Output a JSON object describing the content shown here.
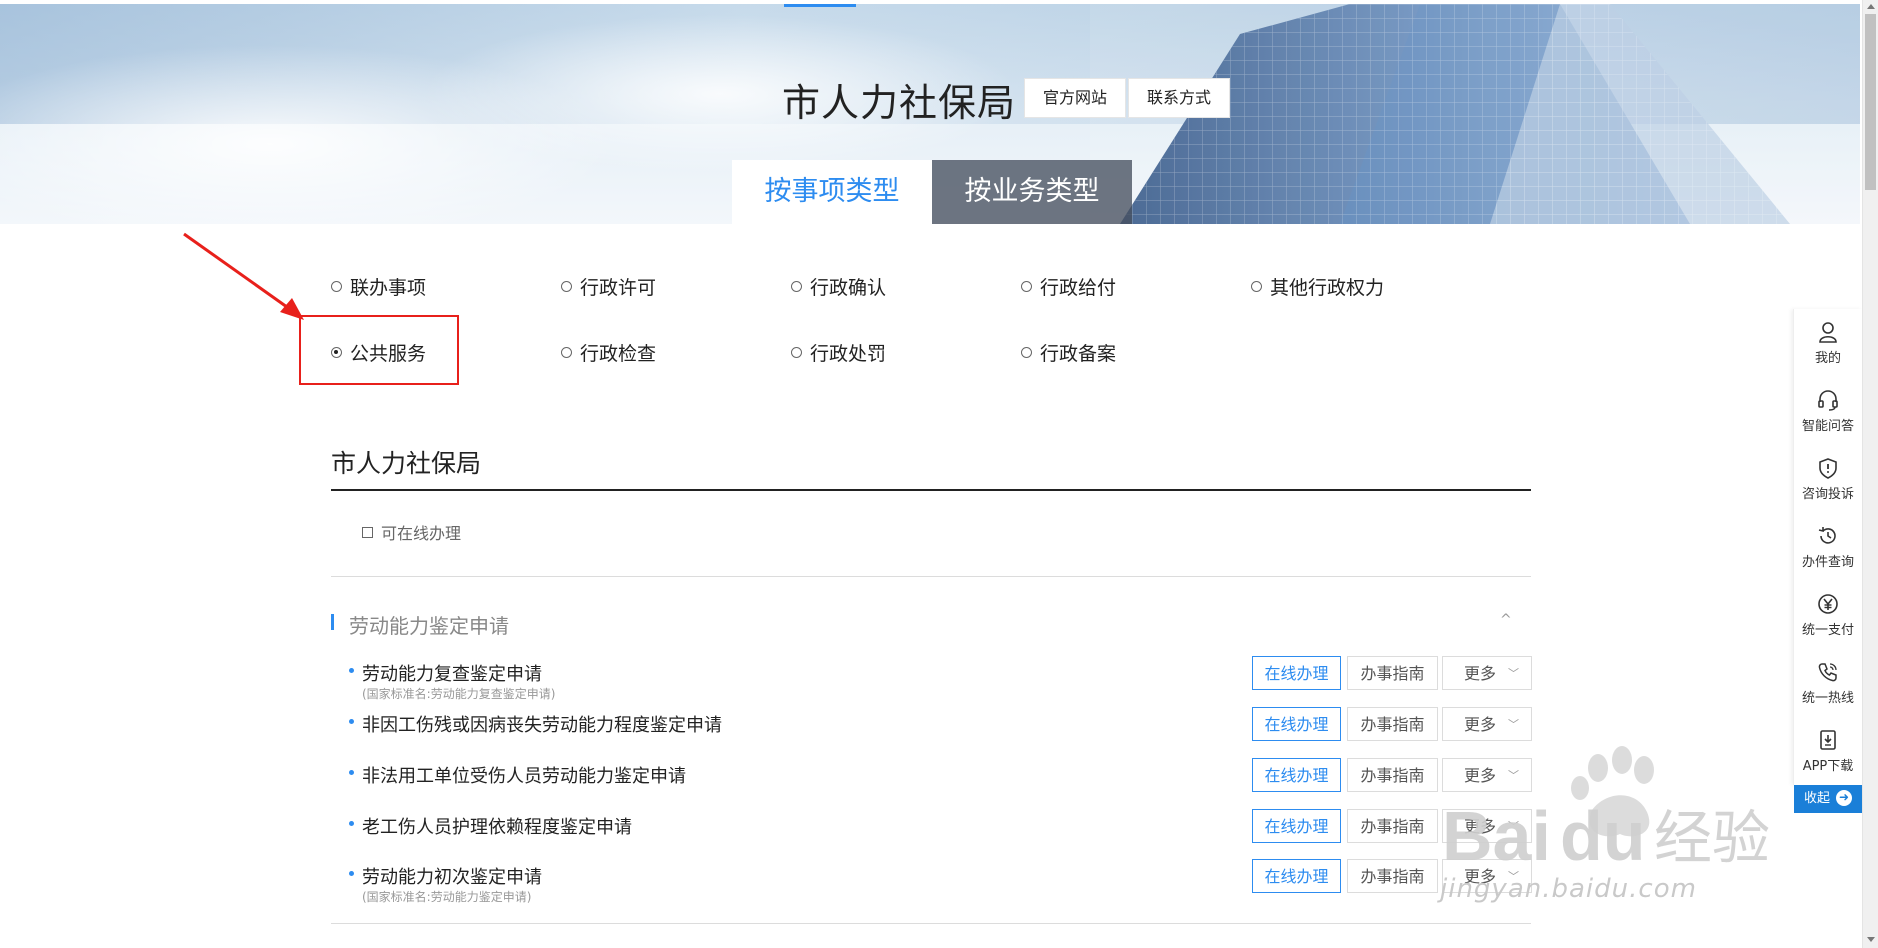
{
  "header": {
    "site_title": "市人力社保局",
    "official_site_label": "官方网站",
    "contact_label": "联系方式"
  },
  "tabs": [
    {
      "label": "按事项类型",
      "active": true
    },
    {
      "label": "按业务类型",
      "active": false
    }
  ],
  "filters": {
    "selected": "公共服务",
    "options": [
      "联办事项",
      "行政许可",
      "行政确认",
      "行政给付",
      "其他行政权力",
      "公共服务",
      "行政检查",
      "行政处罚",
      "行政备案"
    ]
  },
  "section": {
    "title": "市人力社保局",
    "online_filter_label": "可在线办理",
    "group_title": "劳动能力鉴定申请",
    "group_toggle": "^"
  },
  "services": [
    {
      "name": "劳动能力复查鉴定申请",
      "sub": "(国家标准名:劳动能力复查鉴定申请)"
    },
    {
      "name": "非因工伤残或因病丧失劳动能力程度鉴定申请",
      "sub": ""
    },
    {
      "name": "非法用工单位受伤人员劳动能力鉴定申请",
      "sub": ""
    },
    {
      "name": "老工伤人员护理依赖程度鉴定申请",
      "sub": ""
    },
    {
      "name": "劳动能力初次鉴定申请",
      "sub": "(国家标准名:劳动能力鉴定申请)"
    }
  ],
  "row_buttons": {
    "online": "在线办理",
    "guide": "办事指南",
    "more": "更多"
  },
  "sidebar": {
    "items": [
      {
        "label": "我的",
        "icon": "user-icon"
      },
      {
        "label": "智能问答",
        "icon": "headset-icon"
      },
      {
        "label": "咨询投诉",
        "icon": "shield-icon"
      },
      {
        "label": "办件查询",
        "icon": "history-icon"
      },
      {
        "label": "统一支付",
        "icon": "yen-icon"
      },
      {
        "label": "统一热线",
        "icon": "phone-icon"
      },
      {
        "label": "APP下载",
        "icon": "download-icon"
      }
    ],
    "collapse_label": "收起"
  },
  "watermark": {
    "brand": "Baidu经验",
    "url": "jingyan.baidu.com"
  },
  "colors": {
    "accent": "#2d8cf0",
    "highlight": "#e8201b",
    "sidebar_collapse": "#1a7fd8"
  }
}
